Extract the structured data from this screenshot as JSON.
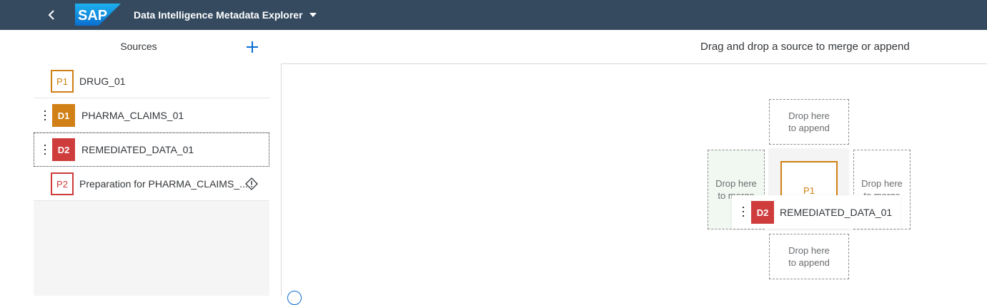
{
  "shellbar": {
    "logo_text": "SAP",
    "app_title": "Data Intelligence Metadata Explorer"
  },
  "sources_panel": {
    "title": "Sources",
    "items": [
      {
        "badge": "P1",
        "label": "DRUG_01"
      },
      {
        "badge": "D1",
        "label": "PHARMA_CLAIMS_01"
      },
      {
        "badge": "D2",
        "label": "REMEDIATED_DATA_01"
      },
      {
        "badge": "P2",
        "label": "Preparation for PHARMA_CLAIMS_..."
      }
    ]
  },
  "main": {
    "hint": "Drag and drop a source to merge or append",
    "drop_append_line1": "Drop here",
    "drop_append_line2": "to append",
    "drop_merge_line1": "Drop here",
    "drop_merge_line2": "to merge",
    "center_badge": "P1",
    "dragging": {
      "badge": "D2",
      "label": "REMEDIATED_DATA_01"
    }
  },
  "colors": {
    "shellbar": "#354a5f",
    "prepared_orange": "#d08014",
    "dataset_red": "#cf3c3c",
    "accent_blue": "#0a6ed1"
  }
}
